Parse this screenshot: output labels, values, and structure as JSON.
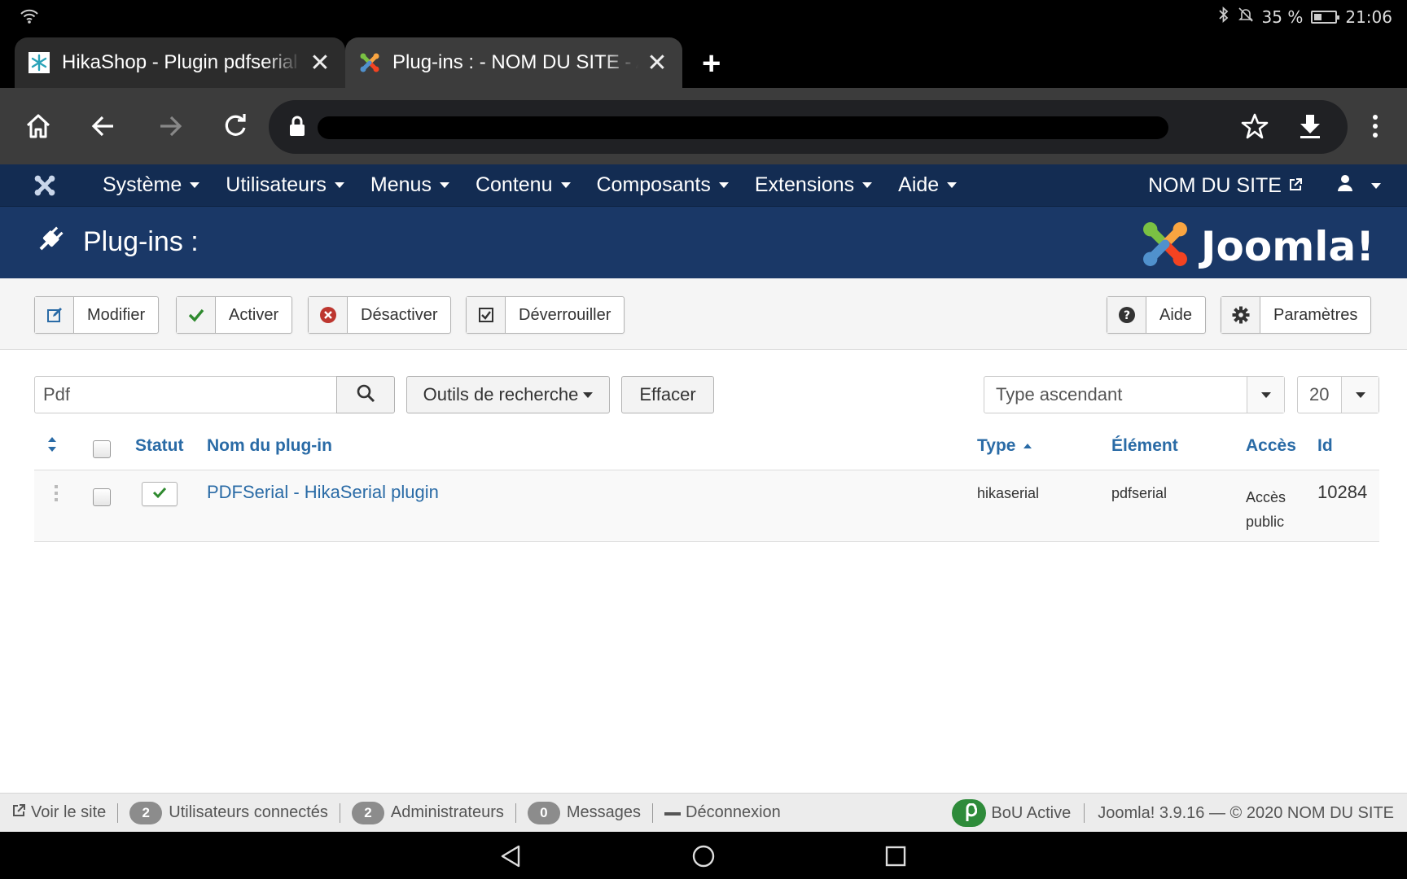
{
  "status_bar": {
    "battery": "35 %",
    "time": "21:06"
  },
  "browser": {
    "tabs": [
      {
        "title": "HikaShop - Plugin pdfserial -",
        "active": false
      },
      {
        "title": "Plug-ins : - NOM DU SITE - A",
        "active": true
      }
    ]
  },
  "joomla_nav": {
    "menus": [
      "Système",
      "Utilisateurs",
      "Menus",
      "Contenu",
      "Composants",
      "Extensions",
      "Aide"
    ],
    "site_link": "NOM DU SITE"
  },
  "header": {
    "title": "Plug-ins :",
    "brand": "Joomla!"
  },
  "toolbar": {
    "edit_label": "Modifier",
    "enable_label": "Activer",
    "disable_label": "Désactiver",
    "checkin_label": "Déverrouiller",
    "help_label": "Aide",
    "options_label": "Paramètres"
  },
  "filters": {
    "search_value": "Pdf",
    "search_tools_label": "Outils de recherche",
    "clear_label": "Effacer",
    "ordering_value": "Type ascendant",
    "limit_value": "20"
  },
  "table": {
    "headers": {
      "status": "Statut",
      "name": "Nom du plug-in",
      "type": "Type",
      "element": "Élément",
      "access": "Accès",
      "id": "Id"
    },
    "rows": [
      {
        "name": "PDFSerial - HikaSerial plugin",
        "type": "hikaserial",
        "element": "pdfserial",
        "access_line1": "Accès",
        "access_line2": "public",
        "id": "10284",
        "enabled": true
      }
    ]
  },
  "footer": {
    "view_site": "Voir le site",
    "users_count": "2",
    "users_label": "Utilisateurs connectés",
    "admins_count": "2",
    "admins_label": "Administrateurs",
    "messages_count": "0",
    "messages_label": "Messages",
    "logout_label": "Déconnexion",
    "bou_label": "BoU Active",
    "version": "Joomla! 3.9.16  —  © 2020 NOM DU SITE"
  },
  "colors": {
    "nav_bg": "#132c52",
    "header_bg": "#1a3867",
    "link": "#2a6ba6",
    "success": "#2f8a2f",
    "danger": "#bd362f"
  }
}
